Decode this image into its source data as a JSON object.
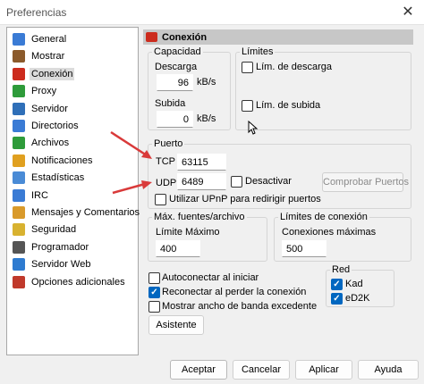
{
  "window": {
    "title": "Preferencias",
    "close_glyph": "✕"
  },
  "sidebar": {
    "items": [
      {
        "label": "General",
        "icon": "general-icon",
        "color": "#3a7bd5"
      },
      {
        "label": "Mostrar",
        "icon": "display-icon",
        "color": "#8b5a2b"
      },
      {
        "label": "Conexión",
        "icon": "connection-icon",
        "color": "#cc2b1d",
        "selected": true
      },
      {
        "label": "Proxy",
        "icon": "proxy-icon",
        "color": "#2e9b3a"
      },
      {
        "label": "Servidor",
        "icon": "server-icon",
        "color": "#2f6fb8"
      },
      {
        "label": "Directorios",
        "icon": "folder-icon",
        "color": "#3a7bd5"
      },
      {
        "label": "Archivos",
        "icon": "files-icon",
        "color": "#2e9b3a"
      },
      {
        "label": "Notificaciones",
        "icon": "notifications-icon",
        "color": "#e0a020"
      },
      {
        "label": "Estadísticas",
        "icon": "statistics-icon",
        "color": "#4a8bd6"
      },
      {
        "label": "IRC",
        "icon": "irc-icon",
        "color": "#3a7bd5"
      },
      {
        "label": "Mensajes y Comentarios",
        "icon": "messages-icon",
        "color": "#d99a2b"
      },
      {
        "label": "Seguridad",
        "icon": "security-icon",
        "color": "#d8b230"
      },
      {
        "label": "Programador",
        "icon": "scheduler-icon",
        "color": "#555555"
      },
      {
        "label": "Servidor Web",
        "icon": "webserver-icon",
        "color": "#2e7bd0"
      },
      {
        "label": "Opciones adicionales",
        "icon": "advanced-options-icon",
        "color": "#c0392b"
      }
    ]
  },
  "panel": {
    "title": "Conexión",
    "capacidad": {
      "legend": "Capacidad",
      "descarga_label": "Descarga",
      "descarga_value": "96",
      "descarga_unit": "kB/s",
      "subida_label": "Subida",
      "subida_value": "0",
      "subida_unit": "kB/s"
    },
    "limites": {
      "legend": "Límites",
      "descarga_label": "Lím. de descarga",
      "subida_label": "Lím. de subida"
    },
    "puerto": {
      "legend": "Puerto",
      "tcp_label": "TCP",
      "tcp_value": "63115",
      "udp_label": "UDP",
      "udp_value": "6489",
      "desactivar_label": "Desactivar",
      "probar_label": "Comprobar Puertos",
      "upnp_label": "Utilizar UPnP para redirigir puertos"
    },
    "max_fuentes": {
      "legend": "Máx. fuentes/archivo",
      "label": "Límite Máximo",
      "value": "400"
    },
    "limites_conexion": {
      "legend": "Límites de conexión",
      "label": "Conexiones máximas",
      "value": "500"
    },
    "options": {
      "autoconectar": "Autoconectar al iniciar",
      "reconectar": "Reconectar al perder la conexión",
      "mostrar_ancho": "Mostrar ancho de banda excedente",
      "asistente": "Asistente"
    },
    "red": {
      "legend": "Red",
      "kad": "Kad",
      "ed2k": "eD2K"
    }
  },
  "footer": {
    "aceptar": "Aceptar",
    "cancelar": "Cancelar",
    "aplicar": "Aplicar",
    "ayuda": "Ayuda"
  },
  "accent_color": "#0067c0",
  "arrow_color": "#d93a3a"
}
